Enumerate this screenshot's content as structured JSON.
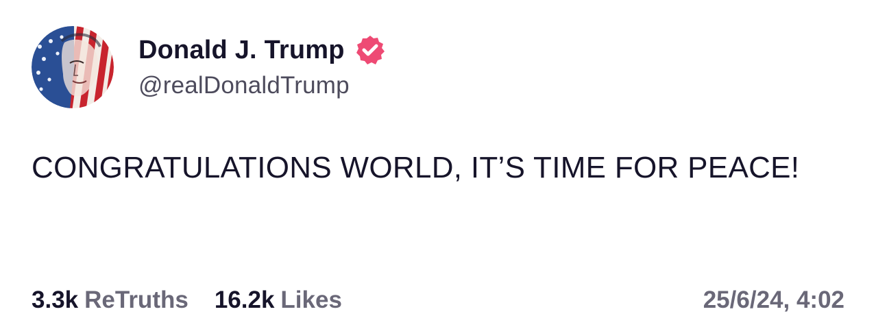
{
  "author": {
    "display_name": "Donald J. Trump",
    "handle": "@realDonaldTrump",
    "avatar_icon": "flag-portrait-avatar",
    "verified_icon": "verified-badge-icon",
    "verified_color": "#ee4a74"
  },
  "post": {
    "text": "CONGRATULATIONS WORLD, IT’S TIME FOR PEACE!"
  },
  "stats": {
    "retruths_count": "3.3k",
    "retruths_label": "ReTruths",
    "likes_count": "16.2k",
    "likes_label": "Likes"
  },
  "timestamp": "25/6/24, 4:02"
}
